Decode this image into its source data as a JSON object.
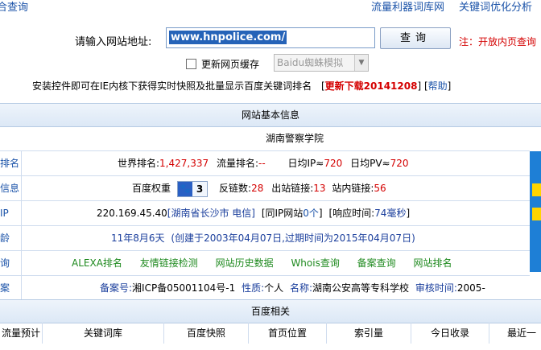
{
  "header": {
    "left_title": "合查询",
    "right_link_1": "流量利器词库网",
    "right_link_2": "关键词优化分析"
  },
  "search": {
    "label": "请输入网站地址:",
    "value": "www.hnpolice.com/",
    "button": "查询",
    "note": "注：开放内页查询"
  },
  "options": {
    "refresh_cache_label": "更新网页缓存",
    "spider_select": "Baidu蜘蛛模拟"
  },
  "notice": {
    "text": "安装控件即可在IE内核下获得实时快照及批量显示百度关键词排名",
    "download_link": "更新下载20141208",
    "help_link": "帮助"
  },
  "basic_section": {
    "title": "网站基本信息",
    "site_name": "湖南警察学院"
  },
  "rank_row": {
    "label": "排名",
    "world_rank_label": "世界排名:",
    "world_rank_value": "1,427,337",
    "traffic_rank_label": "流量排名:",
    "traffic_rank_value": "--",
    "daily_ip_label": "日均IP≈",
    "daily_ip_value": "720",
    "daily_pv_label": "日均PV≈",
    "daily_pv_value": "720"
  },
  "info_row": {
    "label": "信息",
    "baidu_weight_label": "百度权重",
    "baidu_weight_value": "3",
    "backlinks_label": "反链数:",
    "backlinks_value": "28",
    "outbound_label": "出站链接:",
    "outbound_value": "13",
    "inbound_label": "站内链接:",
    "inbound_value": "56"
  },
  "ip_row": {
    "label": "IP",
    "ip": "220.169.45.40",
    "location": "[湖南省长沙市 电信]",
    "same_ip_prefix": "[同IP网站",
    "same_ip_count": "0个",
    "same_ip_suffix": "]",
    "response_prefix": "[响应时间:",
    "response_value": "74毫秒",
    "response_suffix": "]"
  },
  "age_row": {
    "label": "龄",
    "age": "11年8月6天",
    "created_prefix": "(创建于",
    "created_date": "2003年04月07日",
    "expire_prefix": ",过期时间为",
    "expire_date": "2015年04月07日",
    "suffix": ")"
  },
  "query_row": {
    "label": "询",
    "links": [
      "ALEXA排名",
      "友情链接检测",
      "网站历史数据",
      "Whois查询",
      "备案查询",
      "网站排名"
    ]
  },
  "icp_row": {
    "label": "案",
    "icp_label": "备案号:",
    "icp_value": "湘ICP备05001104号-1",
    "nature_label": "性质:",
    "nature_value": "个人",
    "name_label": "名称:",
    "name_value": "湖南公安高等专科学校",
    "audit_label": "审核时间:",
    "audit_value": "2005-"
  },
  "baidu_section": {
    "title": "百度相关",
    "columns": [
      "流量预计",
      "关键词库",
      "百度快照",
      "首页位置",
      "索引量",
      "今日收录",
      "最近一"
    ]
  },
  "colors": {
    "link_blue": "#1a52a8",
    "accent_red": "#d40000",
    "link_green": "#1f8a1f",
    "section_bg": "#dce8f6"
  }
}
